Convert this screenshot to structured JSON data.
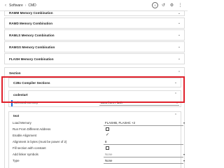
{
  "breadcrumb": {
    "back_icon": "chevron-left-icon",
    "items": [
      "Software",
      "CMD"
    ]
  },
  "toolbar": {
    "info_label": "i",
    "icons": [
      "info-icon",
      "history-icon",
      "settings-icon",
      "more-icon"
    ]
  },
  "sections": [
    {
      "title": "RAMM Memory Combination"
    },
    {
      "title": "RAMD Memory Combination"
    },
    {
      "title": "RAMLS Memory Combination"
    },
    {
      "title": "RAMGS Memory Combination"
    },
    {
      "title": "FLASH Memory Combination"
    },
    {
      "title": "Section"
    },
    {
      "title": "C28x Compiler Sections"
    }
  ],
  "codestart": {
    "title": "codestart",
    "selected_memory_label": "Selected Memory",
    "selected_memory_value": "Boot from Flash"
  },
  "text": {
    "title": "text",
    "rows": [
      {
        "label": "Load Memory",
        "value": "FLASHB, FLASHC +2"
      },
      {
        "label": "Run From Different Address"
      },
      {
        "label": "Enable Alignment"
      },
      {
        "label": "Alignment in bytes (must be power of 2)",
        "value": "8"
      },
      {
        "label": "Fill section with constant"
      },
      {
        "label": "Add linker symbols",
        "value": "None"
      },
      {
        "label": "Type",
        "value": "None"
      }
    ],
    "checkbox_states": {
      "run_from_different_address": false,
      "enable_alignment": true,
      "fill_section": false
    }
  },
  "colors": {
    "highlight": "#e0202a",
    "selected_marker": "#1a6fd8",
    "check": "#333333"
  }
}
